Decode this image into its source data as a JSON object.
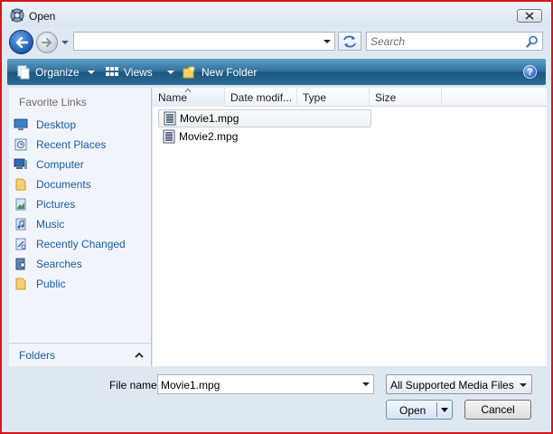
{
  "window": {
    "title": "Open",
    "close_label": "X"
  },
  "nav": {
    "address_value": "",
    "search_placeholder": "Search"
  },
  "toolbar": {
    "organize_label": "Organize",
    "views_label": "Views",
    "new_folder_label": "New Folder",
    "help_label": "?"
  },
  "sidebar": {
    "header": "Favorite Links",
    "items": [
      {
        "label": "Desktop",
        "icon": "desktop-icon"
      },
      {
        "label": "Recent Places",
        "icon": "recent-places-icon"
      },
      {
        "label": "Computer",
        "icon": "computer-icon"
      },
      {
        "label": "Documents",
        "icon": "folder-icon"
      },
      {
        "label": "Pictures",
        "icon": "pictures-icon"
      },
      {
        "label": "Music",
        "icon": "music-icon"
      },
      {
        "label": "Recently Changed",
        "icon": "recently-changed-icon"
      },
      {
        "label": "Searches",
        "icon": "searches-icon"
      },
      {
        "label": "Public",
        "icon": "folder-icon"
      }
    ],
    "folders_label": "Folders"
  },
  "columns": [
    "Name",
    "Date modif...",
    "Type",
    "Size"
  ],
  "files": [
    {
      "name": "Movie1.mpg",
      "selected": true
    },
    {
      "name": "Movie2.mpg",
      "selected": false
    }
  ],
  "footer": {
    "file_name_label": "File name:",
    "file_name_value": "Movie1.mpg",
    "file_type": "All Supported Media Files",
    "open_label": "Open",
    "cancel_label": "Cancel"
  },
  "colors": {
    "accent_link": "#1c5ba4",
    "toolbar": "#2f6f9a",
    "window_border": "#d6161b"
  }
}
